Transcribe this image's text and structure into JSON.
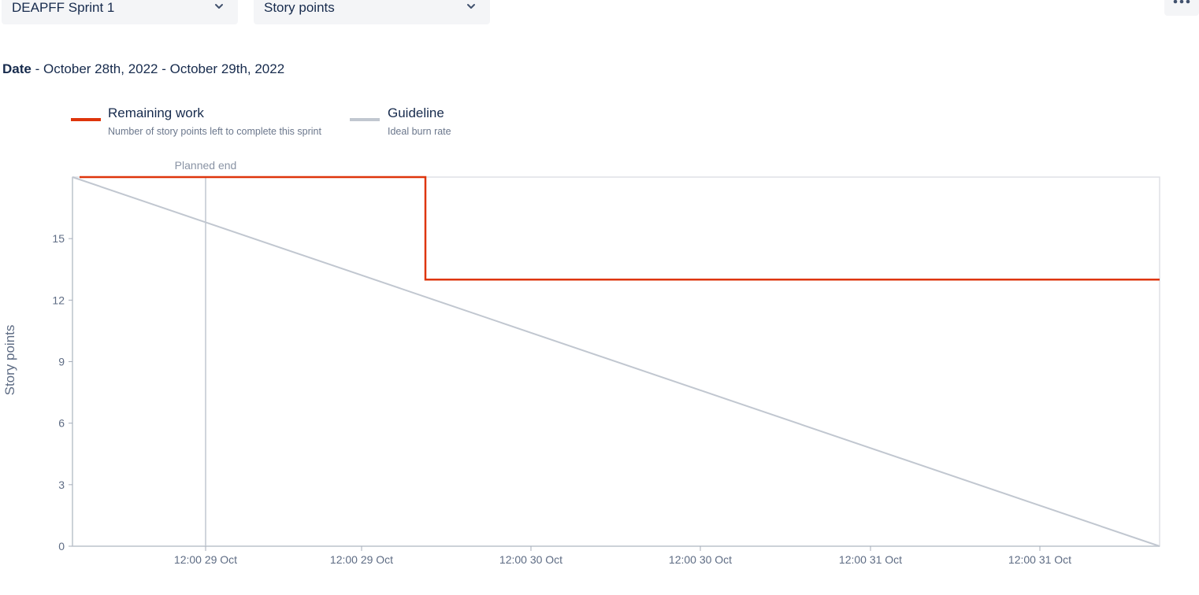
{
  "controls": {
    "sprint_select": "DEAPFF Sprint 1",
    "metric_select": "Story points",
    "more_icon": "more-horizontal-icon",
    "chevron_icon": "chevron-down-icon"
  },
  "date_range": {
    "label": "Date",
    "separator": " - ",
    "value": "October 28th, 2022 - October 29th, 2022"
  },
  "legend": [
    {
      "title": "Remaining work",
      "description": "Number of story points left to complete this sprint",
      "color": "#de350b"
    },
    {
      "title": "Guideline",
      "description": "Ideal burn rate",
      "color": "#c1c7d0"
    }
  ],
  "chart_data": {
    "type": "line",
    "ylabel": "Story points",
    "ylim": [
      0,
      18
    ],
    "yticks": [
      0,
      3,
      6,
      9,
      12,
      15
    ],
    "xticks": [
      "12:00 29 Oct",
      "12:00 29 Oct",
      "12:00 30 Oct",
      "12:00 30 Oct",
      "12:00 31 Oct",
      "12:00 31 Oct"
    ],
    "grid": false,
    "annotations": [
      {
        "label": "Planned end"
      }
    ],
    "series": [
      {
        "name": "Remaining work",
        "color": "#de350b",
        "shape": "step",
        "points": [
          {
            "y": 18
          },
          {
            "y": 18
          },
          {
            "y": 13
          },
          {
            "y": 13
          }
        ]
      },
      {
        "name": "Guideline",
        "color": "#c1c7d0",
        "shape": "line",
        "points": [
          {
            "y": 18
          },
          {
            "y": 0
          }
        ]
      }
    ]
  }
}
